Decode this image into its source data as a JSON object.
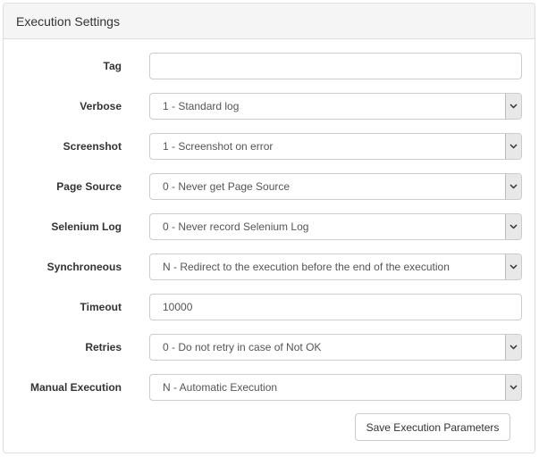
{
  "panel": {
    "title": "Execution Settings"
  },
  "fields": [
    {
      "label": "Tag",
      "value": "",
      "kind": "input"
    },
    {
      "label": "Verbose",
      "value": "1 - Standard log",
      "kind": "select"
    },
    {
      "label": "Screenshot",
      "value": "1 - Screenshot on error",
      "kind": "select"
    },
    {
      "label": "Page Source",
      "value": "0 - Never get Page Source",
      "kind": "select"
    },
    {
      "label": "Selenium Log",
      "value": "0 - Never record Selenium Log",
      "kind": "select"
    },
    {
      "label": "Synchroneous",
      "value": "N - Redirect to the execution before the end of the execution",
      "kind": "select"
    },
    {
      "label": "Timeout",
      "value": "10000",
      "kind": "input"
    },
    {
      "label": "Retries",
      "value": "0 - Do not retry in case of Not OK",
      "kind": "select"
    },
    {
      "label": "Manual Execution",
      "value": "N - Automatic Execution",
      "kind": "select"
    }
  ],
  "actions": {
    "save_label": "Save Execution Parameters"
  },
  "icons": {
    "dropdown": "chevron-down-icon"
  }
}
